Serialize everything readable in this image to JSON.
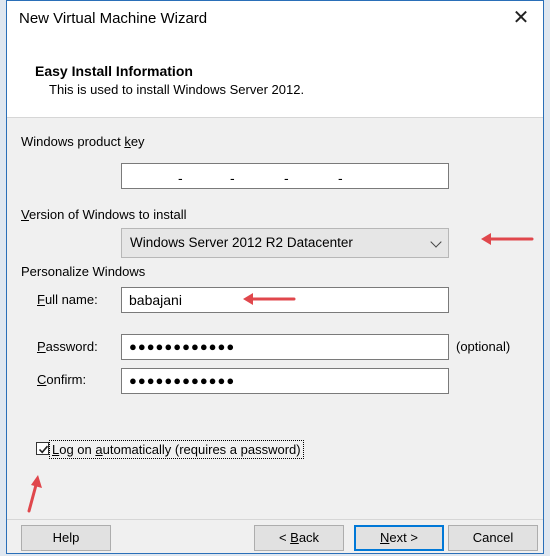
{
  "window": {
    "title": "New Virtual Machine Wizard",
    "close_symbol": "✕"
  },
  "header": {
    "title": "Easy Install Information",
    "subtitle": "This is used to install Windows Server 2012."
  },
  "product_key": {
    "label_pre": "Windows product ",
    "label_accel": "k",
    "label_post": "ey",
    "dashes": [
      "-",
      "-",
      "-",
      "-"
    ]
  },
  "version": {
    "label_accel": "V",
    "label_post": "ersion of Windows to install",
    "selected": "Windows Server 2012 R2 Datacenter"
  },
  "personalize": {
    "section_label": "Personalize Windows",
    "full_name": {
      "label_accel": "F",
      "label_post": "ull name:",
      "value": "babajani"
    },
    "password": {
      "label_accel": "P",
      "label_post": "assword:",
      "value": "●●●●●●●●●●●●",
      "hint": "(optional)"
    },
    "confirm": {
      "label_accel": "C",
      "label_post": "onfirm:",
      "value": "●●●●●●●●●●●●"
    }
  },
  "autologon": {
    "checked": true,
    "label_accel": "L",
    "label_mid": "og on ",
    "label_accel2": "a",
    "label_post": "utomatically (requires a password)"
  },
  "buttons": {
    "help": "Help",
    "back_pre": "< ",
    "back_accel": "B",
    "back_post": "ack",
    "next_accel": "N",
    "next_post": "ext >",
    "cancel": "Cancel"
  },
  "colors": {
    "annotation_arrow": "#e0474c",
    "accent": "#0078d7"
  }
}
